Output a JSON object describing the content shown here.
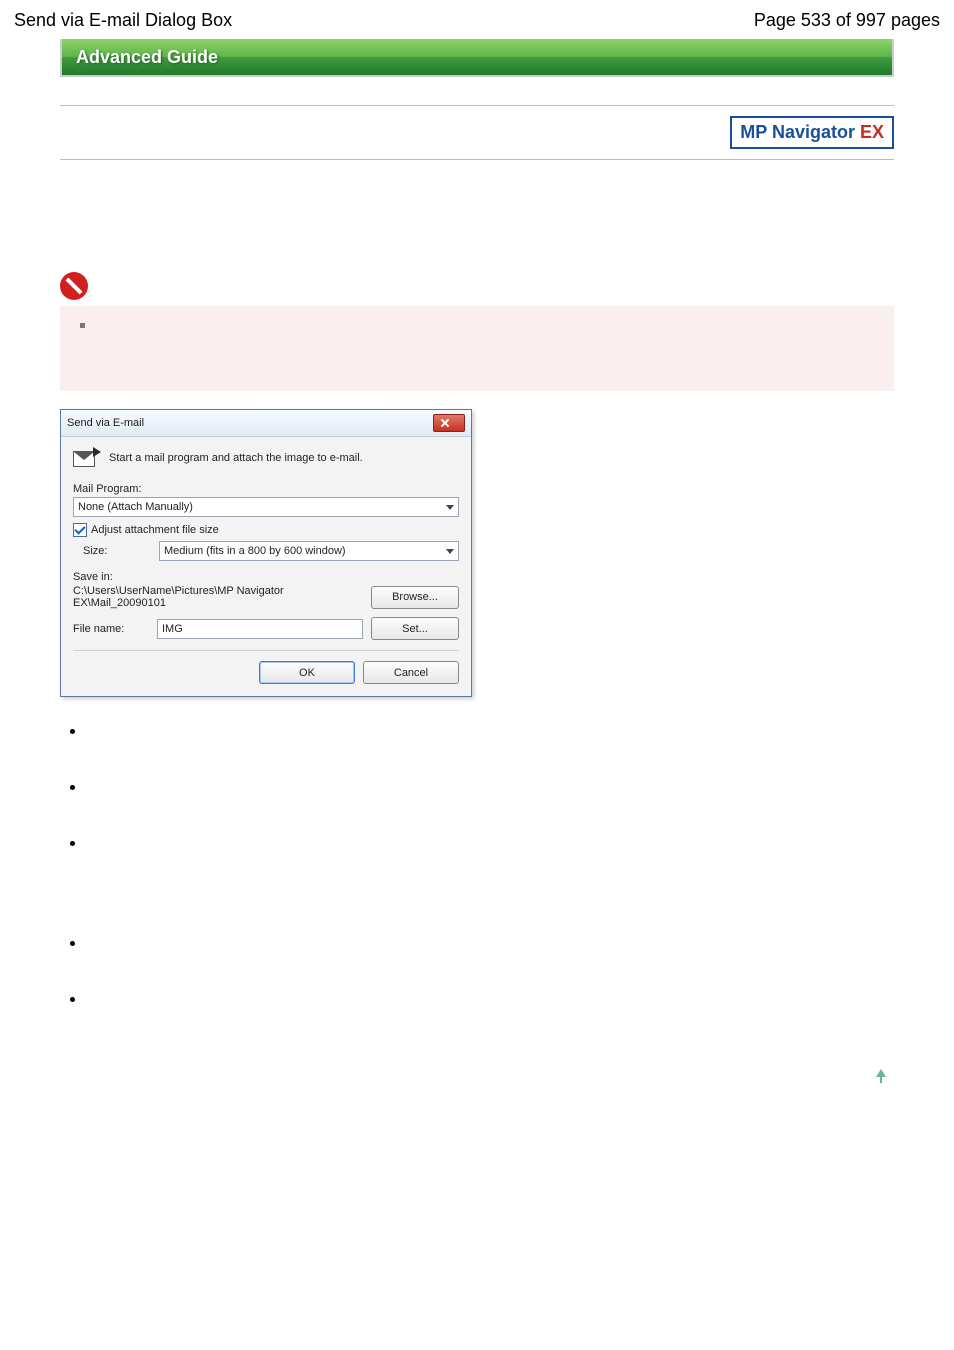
{
  "header": {
    "doc_title": "Send via E-mail Dialog Box",
    "page_counter": "Page 533 of 997 pages"
  },
  "banner": {
    "title": "Advanced Guide"
  },
  "brand": {
    "name": "MP Navigator ",
    "suffix": "EX"
  },
  "dialog": {
    "title": "Send via E-mail",
    "intro": "Start a mail program and attach the image to e-mail.",
    "mail_program_label": "Mail Program:",
    "mail_program_value": "None (Attach Manually)",
    "adjust_label": "Adjust attachment file size",
    "size_label": "Size:",
    "size_value": "Medium (fits in a 800 by 600 window)",
    "savein_label": "Save in:",
    "savein_path": "C:\\Users\\UserName\\Pictures\\MP Navigator EX\\Mail_20090101",
    "browse_btn": "Browse...",
    "filename_label": "File name:",
    "filename_value": "IMG",
    "set_btn": "Set...",
    "ok_btn": "OK",
    "cancel_btn": "Cancel"
  }
}
